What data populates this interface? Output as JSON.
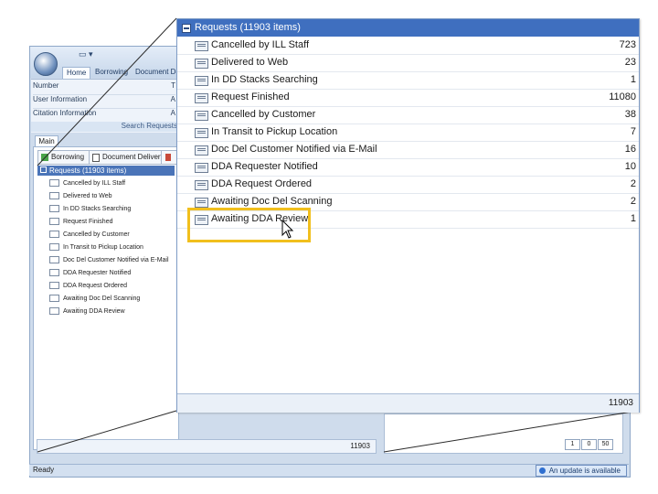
{
  "app": {
    "quick_access": "▭ ▾",
    "tabs": [
      "Home",
      "Borrowing",
      "Document De"
    ],
    "fields": [
      {
        "label": "Number",
        "value": "T"
      },
      {
        "label": "User Information",
        "value": "A"
      },
      {
        "label": "Citation Information",
        "value": "A"
      }
    ],
    "search_label": "Search Requests",
    "main_tab": "Main",
    "bottom_tabs": [
      "Borrowing",
      "Document Delivery"
    ],
    "tree_header": "Requests (11903 items)",
    "tree_items": [
      "Cancelled by ILL Staff",
      "Delivered to Web",
      "In DD Stacks Searching",
      "Request Finished",
      "Cancelled by Customer",
      "In Transit to Pickup Location",
      "Doc Del Customer Notified via E-Mail",
      "DDA Requester Notified",
      "DDA Request Ordered",
      "Awaiting Doc Del Scanning",
      "Awaiting DDA Review"
    ],
    "footer_count": "11903",
    "pager": [
      "1",
      "0",
      "50"
    ],
    "status_text": "Ready",
    "update_badge": "An update is available"
  },
  "zoom": {
    "header": "Requests (11903 items)",
    "rows": [
      {
        "label": "Cancelled by ILL Staff",
        "count": "723"
      },
      {
        "label": "Delivered to Web",
        "count": "23"
      },
      {
        "label": "In DD Stacks Searching",
        "count": "1"
      },
      {
        "label": "Request Finished",
        "count": "11080"
      },
      {
        "label": "Cancelled by Customer",
        "count": "38"
      },
      {
        "label": "In Transit to Pickup Location",
        "count": "7"
      },
      {
        "label": "Doc Del Customer Notified via E-Mail",
        "count": "16"
      },
      {
        "label": "DDA Requester Notified",
        "count": "10"
      },
      {
        "label": "DDA Request Ordered",
        "count": "2"
      },
      {
        "label": "Awaiting Doc Del Scanning",
        "count": "2"
      },
      {
        "label": "Awaiting DDA Review",
        "count": "1"
      }
    ],
    "footer_count": "11903",
    "highlight_color": "#f1bf1d",
    "header_color": "#3f6fbf"
  }
}
